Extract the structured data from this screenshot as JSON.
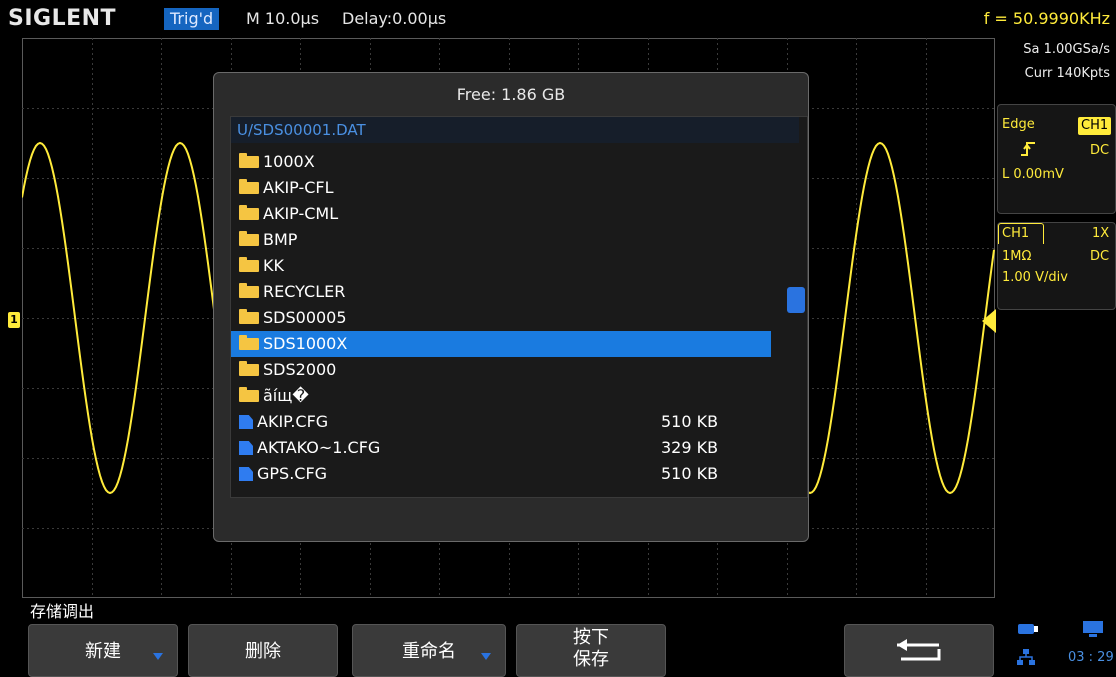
{
  "brand": "SIGLENT",
  "status": {
    "trigger_state": "Trig'd",
    "timebase": "M 10.0μs",
    "delay": "Delay:0.00μs",
    "frequency": "f = 50.9990KHz"
  },
  "acquisition": {
    "sample_rate": "Sa 1.00GSa/s",
    "memory": "Curr 140Kpts"
  },
  "trigger_panel": {
    "type": "Edge",
    "source": "CH1",
    "coupling": "DC",
    "level": "L  0.00mV"
  },
  "channel_panel": {
    "channel": "CH1",
    "probe": "1X",
    "impedance": "1MΩ",
    "coupling": "DC",
    "scale": "1.00 V/div"
  },
  "markers": {
    "ch1_label": "1"
  },
  "dialog": {
    "free_space": "Free: 1.86 GB",
    "path": "U/SDS00001.DAT",
    "items": [
      {
        "name": "1000X",
        "kind": "folder",
        "size": ""
      },
      {
        "name": "AKIP-CFL",
        "kind": "folder",
        "size": ""
      },
      {
        "name": "AKIP-CML",
        "kind": "folder",
        "size": ""
      },
      {
        "name": "BMP",
        "kind": "folder",
        "size": ""
      },
      {
        "name": "KK",
        "kind": "folder",
        "size": ""
      },
      {
        "name": "RECYCLER",
        "kind": "folder",
        "size": ""
      },
      {
        "name": "SDS00005",
        "kind": "folder",
        "size": ""
      },
      {
        "name": "SDS1000X",
        "kind": "folder",
        "size": "",
        "selected": true
      },
      {
        "name": "SDS2000",
        "kind": "folder",
        "size": ""
      },
      {
        "name": "ãíщ�",
        "kind": "folder",
        "size": ""
      },
      {
        "name": "AKIP.CFG",
        "kind": "file",
        "size": "510 KB"
      },
      {
        "name": "AKTAKO~1.CFG",
        "kind": "file",
        "size": "329 KB"
      },
      {
        "name": "GPS.CFG",
        "kind": "file",
        "size": "510 KB"
      }
    ]
  },
  "menu": {
    "title": "存储调出",
    "softkeys": {
      "new": "新建",
      "delete": "删除",
      "rename": "重命名",
      "press_line1": "按下",
      "press_line2": "保存"
    }
  },
  "system": {
    "clock": "03 : 29"
  },
  "colors": {
    "waveform": "#ffeb3b",
    "accent": "#1a7be0",
    "folder": "#f5c542",
    "file": "#2f7cf0"
  },
  "icons": [
    "folder-icon",
    "file-icon",
    "return-arrow-icon",
    "usb-icon",
    "monitor-icon",
    "network-icon",
    "trigger-edge-icon"
  ]
}
